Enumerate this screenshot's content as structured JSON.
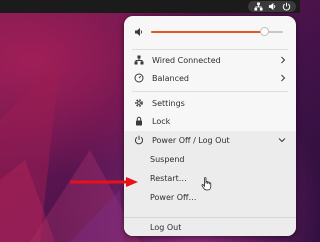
{
  "colors": {
    "accent": "#e95420",
    "arrow": "#e8111a"
  },
  "topbar": {
    "icons": [
      "network-icon",
      "volume-icon",
      "power-icon"
    ]
  },
  "quick_settings": {
    "volume": {
      "icon": "speaker-icon",
      "level": 0.86
    },
    "wired": {
      "label": "Wired Connected",
      "icon": "network-icon"
    },
    "power_mode": {
      "label": "Balanced",
      "icon": "power-mode-icon"
    },
    "settings": {
      "label": "Settings",
      "icon": "gear-icon"
    },
    "lock": {
      "label": "Lock",
      "icon": "lock-icon"
    },
    "power_menu": {
      "label": "Power Off / Log Out",
      "icon": "power-icon",
      "items": [
        "Suspend",
        "Restart…",
        "Power Off…",
        "Log Out"
      ]
    }
  }
}
